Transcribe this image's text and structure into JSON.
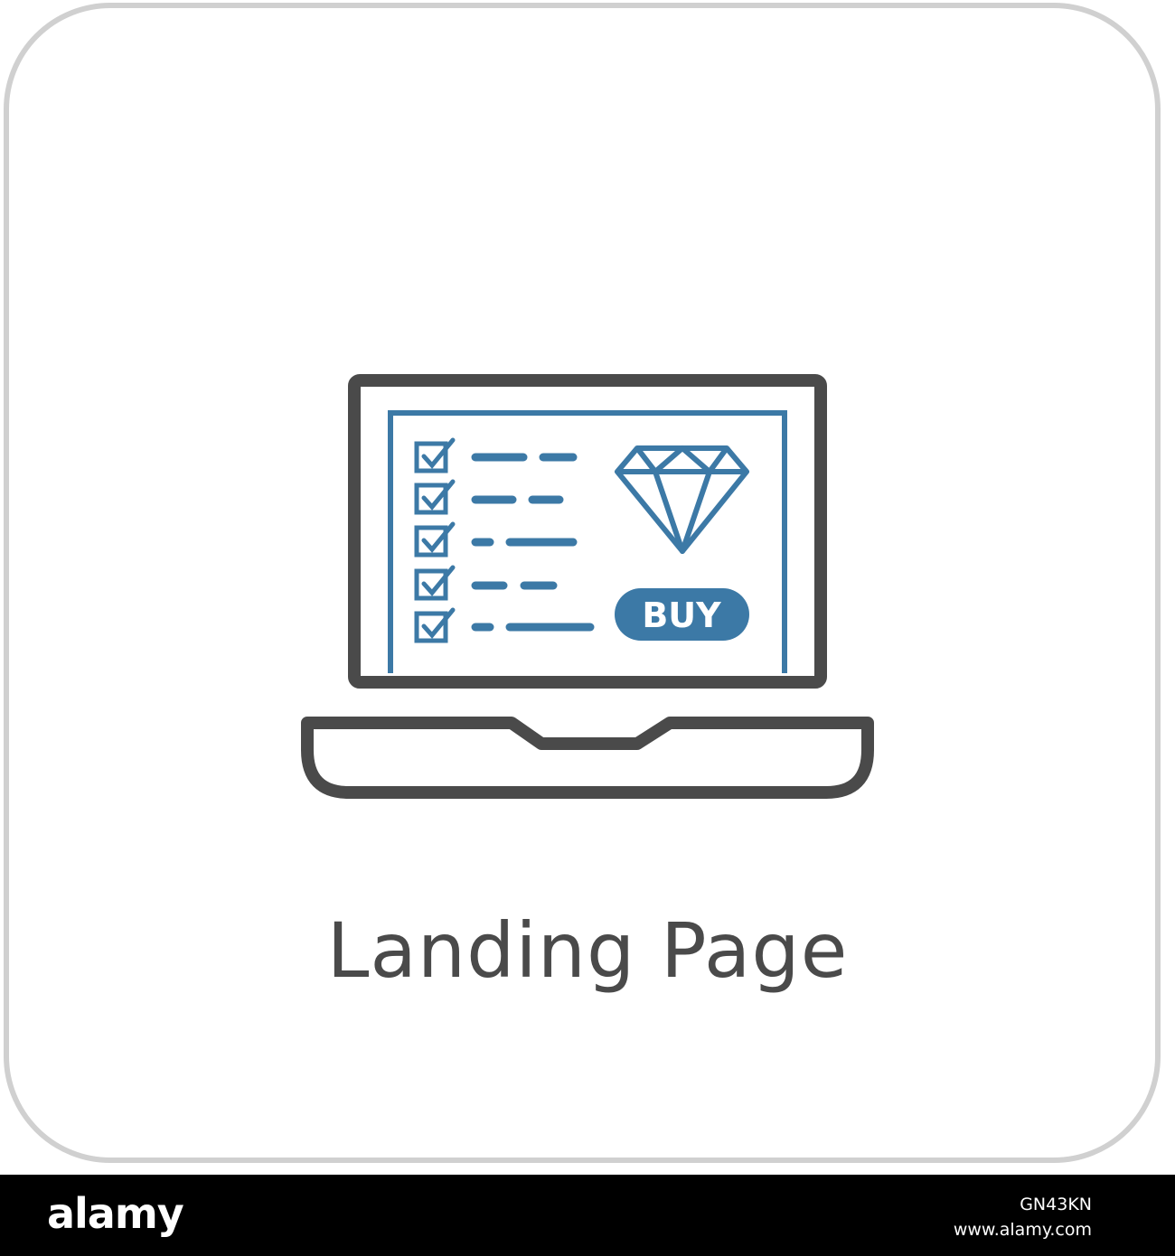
{
  "icon": {
    "name": "laptop-landing-page-icon",
    "colors": {
      "outline": "#4a4a4a",
      "accent": "#3c79a6",
      "card_border": "#d0d0d0"
    },
    "button_label": "BUY",
    "checklist_count": 5
  },
  "caption": {
    "title": "Landing Page"
  },
  "footer": {
    "brand": "alamy",
    "image_code": "GN43KN",
    "url": "www.alamy.com"
  }
}
